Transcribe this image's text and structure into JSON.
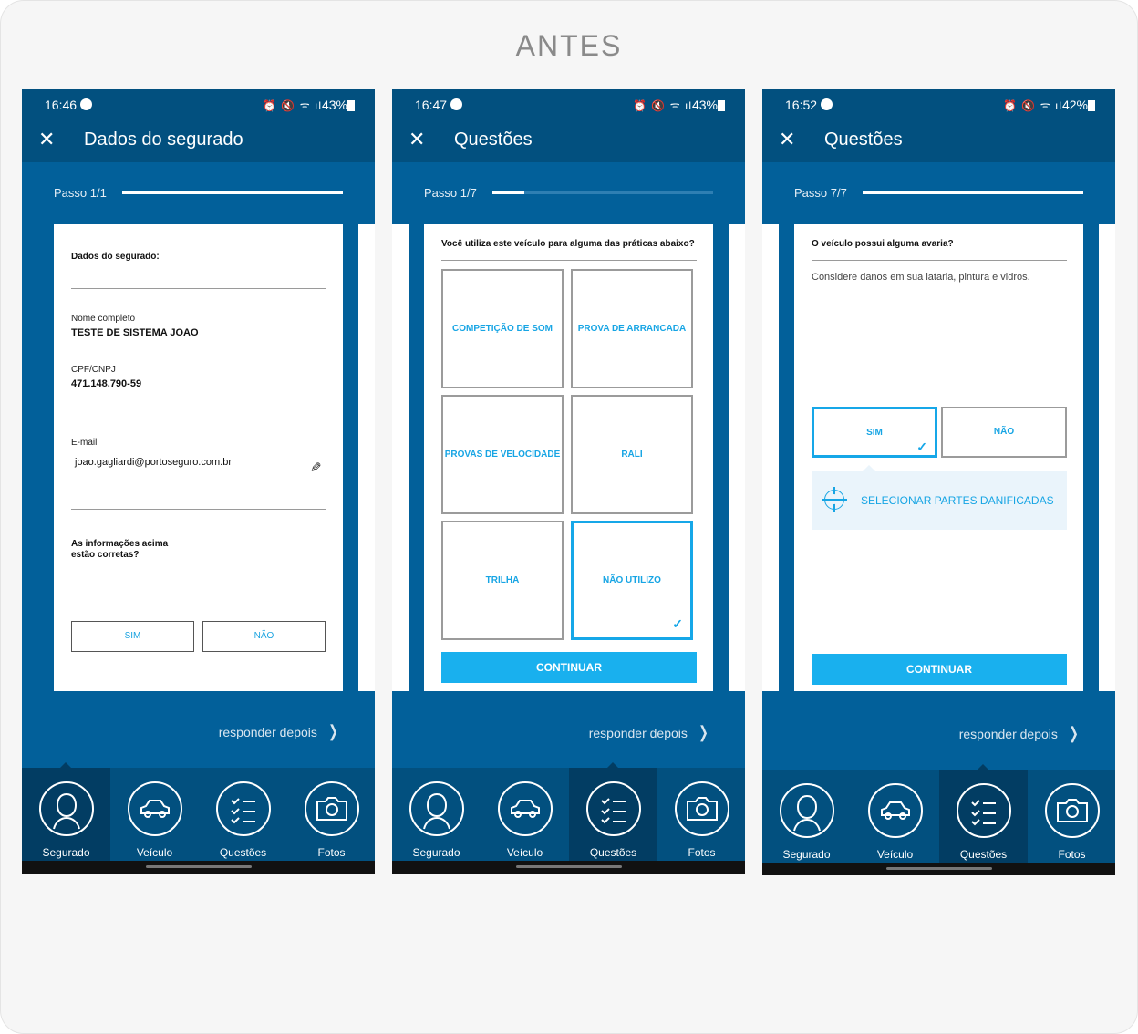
{
  "page_title": "ANTES",
  "nav": {
    "segurado": "Segurado",
    "veiculo": "Veículo",
    "questoes": "Questões",
    "fotos": "Fotos"
  },
  "defer_label": "responder depois",
  "screens": [
    {
      "status": {
        "time": "16:46",
        "battery": "43%"
      },
      "title": "Dados do segurado",
      "step": "Passo 1/1",
      "progress": 1.0,
      "section": "Dados do segurado:",
      "fields": [
        {
          "label": "Nome completo",
          "value": "TESTE DE SISTEMA JOAO"
        },
        {
          "label": "CPF/CNPJ",
          "value": "471.148.790-59"
        },
        {
          "label": "E-mail",
          "value": "joao.gagliardi@portoseguro.com.br"
        }
      ],
      "confirm_q1": "As informações acima",
      "confirm_q2": "estão corretas?",
      "yes": "SIM",
      "no": "NÃO",
      "active_nav": "segurado"
    },
    {
      "status": {
        "time": "16:47",
        "battery": "43%"
      },
      "title": "Questões",
      "step": "Passo 1/7",
      "progress": 0.143,
      "question": "Você utiliza este veículo para alguma das práticas abaixo?",
      "options": [
        "COMPETIÇÃO DE SOM",
        "PROVA DE ARRANCADA",
        "PROVAS DE VELOCIDADE",
        "RALI",
        "TRILHA",
        "NÃO UTILIZO"
      ],
      "selected_option": "NÃO UTILIZO",
      "continue": "CONTINUAR",
      "active_nav": "questoes"
    },
    {
      "status": {
        "time": "16:52",
        "battery": "42%"
      },
      "title": "Questões",
      "step": "Passo 7/7",
      "progress": 1.0,
      "question": "O veículo possui alguma avaria?",
      "hint": "Considere danos em sua lataria, pintura e vidros.",
      "yes": "SIM",
      "no": "NÃO",
      "selected": "SIM",
      "parts_button": "SELECIONAR PARTES DANIFICADAS",
      "continue": "CONTINUAR",
      "active_nav": "questoes"
    }
  ]
}
